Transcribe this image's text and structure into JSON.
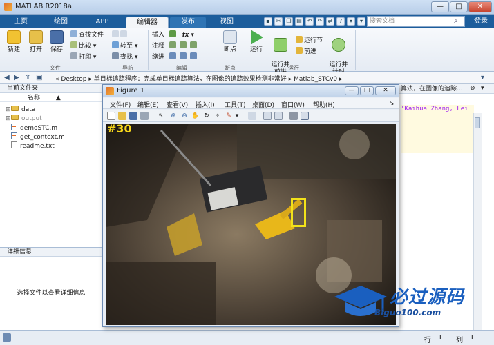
{
  "window": {
    "title": "MATLAB R2018a",
    "minimize": "—",
    "maximize": "□",
    "close": "✕"
  },
  "tabs": [
    {
      "label": "主页"
    },
    {
      "label": "绘图"
    },
    {
      "label": "APP"
    },
    {
      "label": "编辑器"
    },
    {
      "label": "发布"
    },
    {
      "label": "视图"
    }
  ],
  "search": {
    "placeholder": "搜索文档"
  },
  "login": "登录",
  "ribbon": {
    "file": {
      "new": "新建",
      "open": "打开",
      "save": "保存",
      "find_files": "查找文件",
      "compare": "比较",
      "print": "打印",
      "group": "文件"
    },
    "navigate": {
      "goto": "转至",
      "find": "查找",
      "group": "导航"
    },
    "edit": {
      "insert": "插入",
      "comment": "注释",
      "indent": "缩进",
      "fx": "fx",
      "group": "编辑"
    },
    "breakpoints": {
      "breakpoints": "断点",
      "group": "断点"
    },
    "run": {
      "run": "运行",
      "run_advance": "运行并\n前进",
      "run_section": "运行节",
      "advance": "前进",
      "run_time": "运行并\n计时",
      "group": "运行"
    }
  },
  "address": {
    "path_parts": [
      "«",
      "Desktop",
      "▸",
      "单目标追踪程序：完成单目标追踪算法，在图像的追踪效果检测非常好",
      "▸",
      "Matlab_STCv0",
      "▸"
    ]
  },
  "current_folder": {
    "header": "当前文件夹",
    "name_col": "名称",
    "sort_arrow": "▲",
    "items": [
      {
        "name": "data",
        "type": "folder"
      },
      {
        "name": "output",
        "type": "folder"
      },
      {
        "name": "demoSTC.m",
        "type": "mfile"
      },
      {
        "name": "get_context.m",
        "type": "mfile"
      },
      {
        "name": "readme.txt",
        "type": "txt"
      }
    ]
  },
  "details": {
    "header": "详细信息",
    "message": "选择文件以查看详细信息"
  },
  "editor": {
    "tab_title": "算法，在图像的追踪...",
    "code_fragment": "'Kaihua Zhang, Lei"
  },
  "figure": {
    "title": "Figure 1",
    "menus": [
      "文件(F)",
      "编辑(E)",
      "查看(V)",
      "插入(I)",
      "工具(T)",
      "桌面(D)",
      "窗口(W)",
      "帮助(H)"
    ],
    "frame_label": "#30"
  },
  "status": {
    "row_label": "行",
    "row": "1",
    "col_label": "列",
    "col": "1"
  },
  "watermark": {
    "text": "必过源码",
    "url": "Biguo100.com"
  },
  "colors": {
    "tabbar": "#1c5d9c",
    "accent": "#2f74b4",
    "track_box": "#f2e21a"
  }
}
